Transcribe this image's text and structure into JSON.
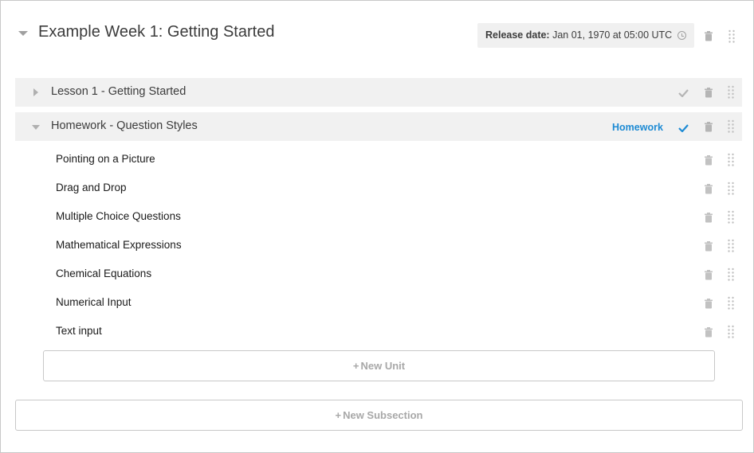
{
  "section": {
    "title": "Example Week 1: Getting Started",
    "release_label": "Release date:",
    "release_value": "Jan 01, 1970 at 05:00 UTC"
  },
  "subsections": [
    {
      "title": "Lesson 1 - Getting Started",
      "grade": "",
      "expanded": false
    },
    {
      "title": "Homework - Question Styles",
      "grade": "Homework",
      "expanded": true
    }
  ],
  "units": [
    "Pointing on a Picture",
    "Drag and Drop",
    "Multiple Choice Questions",
    "Mathematical Expressions",
    "Chemical Equations",
    "Numerical Input",
    "Text input"
  ],
  "buttons": {
    "new_unit": "New Unit",
    "new_subsection": "New Subsection"
  },
  "colors": {
    "accent_blue": "#1e8bd4",
    "icon_gray": "#a0a0a0",
    "row_bg": "#f1f1f1"
  }
}
